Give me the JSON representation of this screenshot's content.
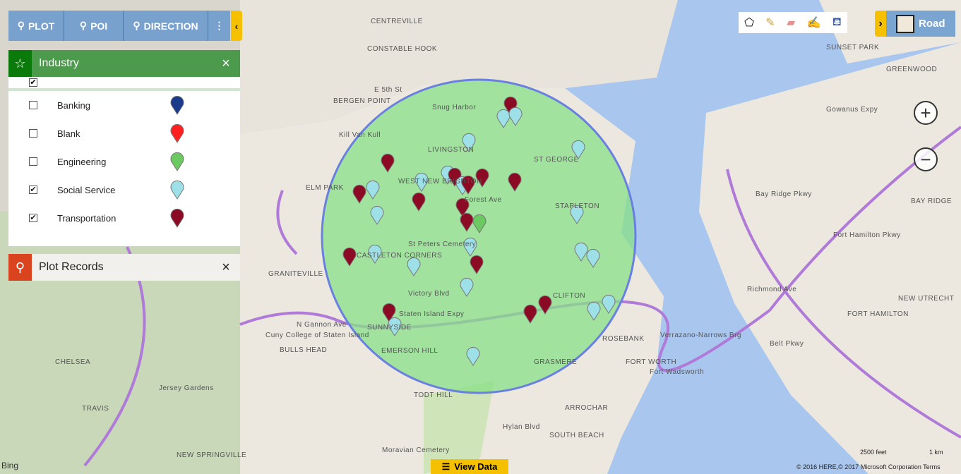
{
  "toolbar": {
    "plot": "PLOT",
    "poi": "POI",
    "direction": "DIRECTION",
    "more_icon": "vertical-ellipsis",
    "collapse_icon": "chevron-left"
  },
  "industry_panel": {
    "title": "Industry",
    "icon": "star",
    "close": "×",
    "items": [
      {
        "label": "Banking",
        "checked": false,
        "color": "#1a3a8c"
      },
      {
        "label": "Blank",
        "checked": false,
        "color": "#ff2020"
      },
      {
        "label": "Engineering",
        "checked": false,
        "color": "#6cc860"
      },
      {
        "label": "Social Service",
        "checked": true,
        "color": "#9ee0e8"
      },
      {
        "label": "Transportation",
        "checked": true,
        "color": "#8b0a24"
      }
    ],
    "select_all_checked": true
  },
  "plot_panel": {
    "title": "Plot Records",
    "close": "×",
    "accent": "#d9431e"
  },
  "drawing_tools": [
    "polygon-icon",
    "pencil-icon",
    "eraser-icon",
    "edit-style-icon",
    "fill-icon"
  ],
  "map_type": {
    "label": "Road"
  },
  "zoom": {
    "in": "+",
    "out": "−"
  },
  "view_data": "View Data",
  "scale": {
    "feet": "2500 feet",
    "km": "1 km"
  },
  "copyright": "© 2016 HERE,© 2017 Microsoft Corporation  Terms",
  "bing": "Bing",
  "radius_color": "#88e088",
  "map_labels": [
    "CENTREVILLE",
    "CONSTABLE HOOK",
    "BERGEN POINT",
    "E 5th St",
    "Kill Van Kull",
    "LIVINGSTON",
    "Snug Harbor",
    "ST GEORGE",
    "WEST NEW BRIGHTON",
    "Forest Ave",
    "ELM PARK",
    "STAPLETON",
    "CASTLETON CORNERS",
    "St Peters Cemetery",
    "Victory Blvd",
    "CLIFTON",
    "Staten Island Expy",
    "SUNNYSIDE",
    "ROSEBANK",
    "EMERSON HILL",
    "GRASMERE",
    "FORT WORTH",
    "Fort Wadsworth",
    "BULLS HEAD",
    "TODT HILL",
    "ARROCHAR",
    "SOUTH BEACH",
    "Verrazano-Narrows Brg",
    "Belt Pkwy",
    "Gowanus Expy",
    "SUNSET PARK",
    "GREENWOOD",
    "BAY RIDGE",
    "FORT HAMILTON",
    "NEW UTRECHT",
    "GRANITEVILLE",
    "CHELSEA",
    "TRAVIS",
    "Jersey Gardens",
    "Richmond Ave",
    "NEW SPRINGVILLE",
    "Moravian Cemetery",
    "Fort Hamilton Pkwy",
    "Bay Ridge Pkwy",
    "Hylan Blvd",
    "N Gannon Ave",
    "Cuny College of Staten Island"
  ]
}
